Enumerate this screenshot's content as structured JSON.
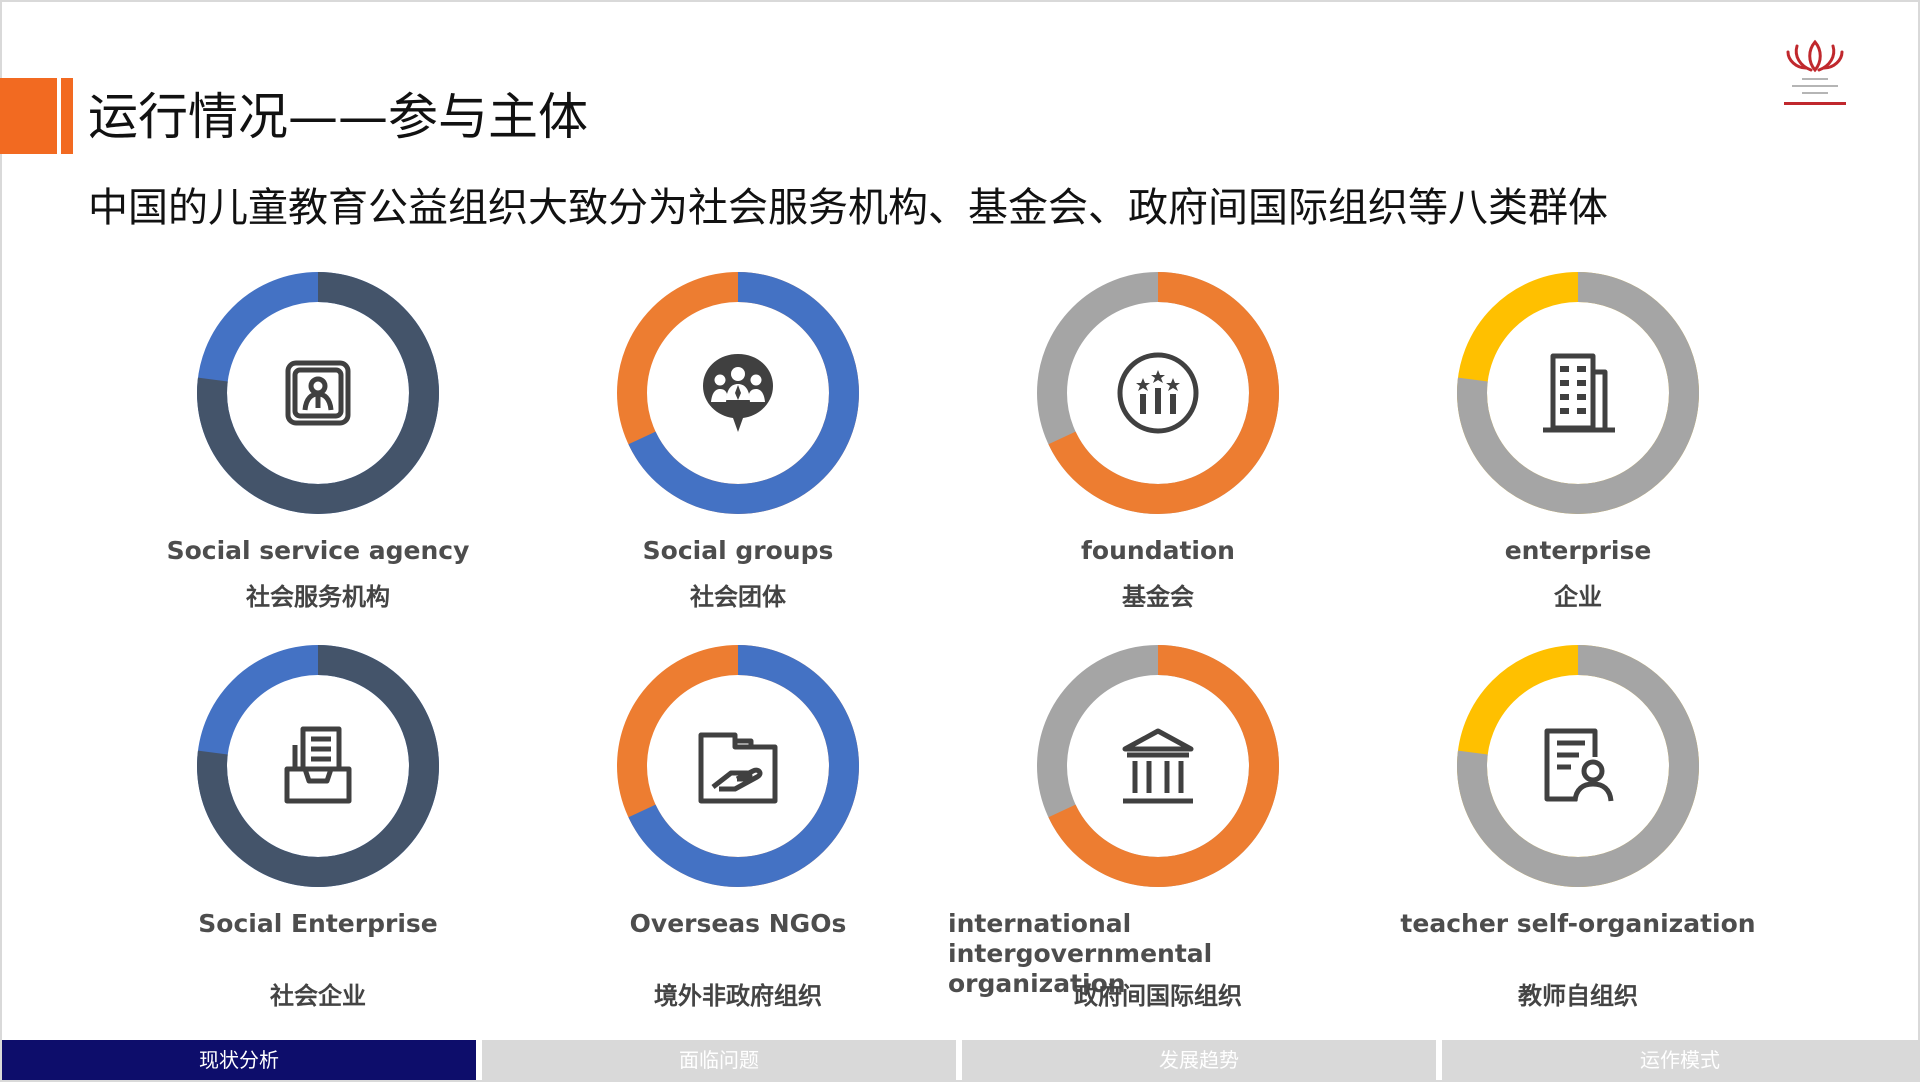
{
  "header": {
    "title": "运行情况——参与主体",
    "subtitle": "中国的儿童教育公益组织大致分为社会服务机构、基金会、政府间国际组织等八类群体"
  },
  "logo": {
    "name": "world-philanthropy-forum-logo",
    "color": "#c0282d"
  },
  "colors": {
    "accent": "#f26a21",
    "navy": "#0d0d6b",
    "slate": "#44546a",
    "blue": "#4472c4",
    "orange": "#ed7d31",
    "gray": "#a5a5a5",
    "gold": "#ffc000"
  },
  "categories": [
    {
      "en": "Social service agency",
      "cn": "社会服务机构",
      "icon": "person-badge-icon",
      "primary": "#44546a",
      "secondary": "#4472c4",
      "primary_pct": 77
    },
    {
      "en": "Social groups",
      "cn": "社会团体",
      "icon": "people-group-icon",
      "primary": "#4472c4",
      "secondary": "#ed7d31",
      "primary_pct": 68
    },
    {
      "en": "foundation",
      "cn": "基金会",
      "icon": "stars-badge-icon",
      "primary": "#ed7d31",
      "secondary": "#a5a5a5",
      "primary_pct": 68
    },
    {
      "en": "enterprise",
      "cn": "企业",
      "icon": "office-building-icon",
      "primary": "#a5a5a5",
      "secondary": "#ffc000",
      "primary_pct": 77
    },
    {
      "en": "Social Enterprise",
      "cn": "社会企业",
      "icon": "document-tray-icon",
      "primary": "#44546a",
      "secondary": "#4472c4",
      "primary_pct": 77
    },
    {
      "en": "Overseas NGOs",
      "cn": "境外非政府组织",
      "icon": "folder-hand-icon",
      "primary": "#4472c4",
      "secondary": "#ed7d31",
      "primary_pct": 68
    },
    {
      "en": "international intergovernmental organization",
      "cn": "政府间国际组织",
      "icon": "institution-building-icon",
      "primary": "#ed7d31",
      "secondary": "#a5a5a5",
      "primary_pct": 68
    },
    {
      "en": "teacher self-organization",
      "cn": "教师自组织",
      "icon": "clipboard-person-icon",
      "primary": "#a5a5a5",
      "secondary": "#ffc000",
      "primary_pct": 77
    }
  ],
  "footer_tabs": [
    {
      "label": "现状分析",
      "active": true
    },
    {
      "label": "面临问题",
      "active": false
    },
    {
      "label": "发展趋势",
      "active": false
    },
    {
      "label": "运作模式",
      "active": false
    }
  ]
}
